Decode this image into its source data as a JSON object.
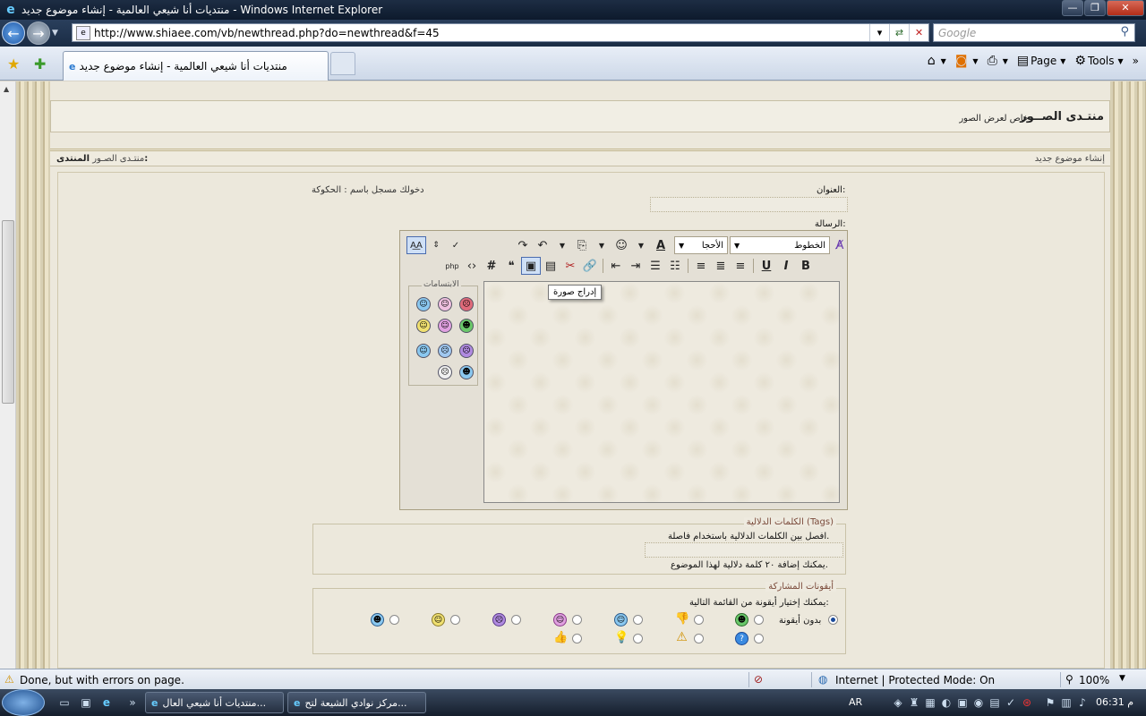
{
  "window": {
    "title": "منتديات أنا شيعي العالمية - إنشاء موضوع جديد - Windows Internet Explorer"
  },
  "browser": {
    "url": "http://www.shiaee.com/vb/newthread.php?do=newthread&f=45",
    "search_placeholder": "Google",
    "tab_title": "منتديات أنا شيعي العالمية - إنشاء موضوع جديد",
    "cmd_page": "Page",
    "cmd_tools": "Tools"
  },
  "forum": {
    "name": "منتـدى الصــور",
    "desc": "خاص لعرض الصور",
    "crumb_label": "المنتدى:",
    "crumb_value": "منتـدى الصـور",
    "new_thread": "إنشاء موضوع جديد"
  },
  "form": {
    "title_label": "العنوان:",
    "logged_in": "دخولك مسجل باسم : الحكوكة",
    "message_label": "الرسالة:",
    "font_select": "الخطوط",
    "size_select": "الأحجا",
    "tooltip": "إدراج صورة",
    "smilies_legend": "الابتسامات"
  },
  "tags": {
    "legend": "الكلمات الدلالية (Tags)",
    "hint": "افصل بين الكلمات الدلالية باستخدام فاصلة.",
    "limit": "يمكنك إضافة ٢٠ كلمة دلالية لهذا الموضوع."
  },
  "icons": {
    "legend": "أيقونات المشاركة",
    "hint": "يمكنك إختيار أيقونة من القائمة التالية:",
    "none_label": "بدون أيقونة"
  },
  "status": {
    "message": "Done, but with errors on page.",
    "zone": "Internet | Protected Mode: On",
    "zoom": "100%"
  },
  "taskbar": {
    "task1": "منتديات أنا شيعي العال...",
    "task2": "مركز نوادي الشيعة لتح...",
    "lang": "AR",
    "clock": "م 06:31"
  }
}
